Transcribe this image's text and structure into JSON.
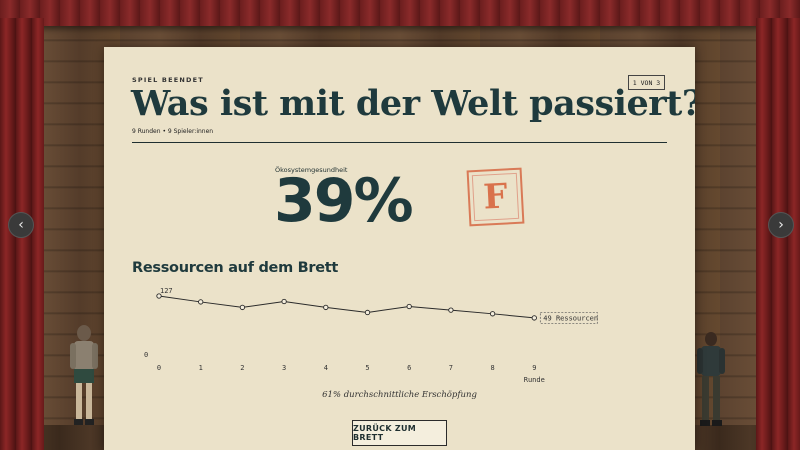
{
  "header": {
    "eyebrow": "SPIEL BEENDET",
    "title": "Was ist mit der Welt passiert?",
    "meta": "9 Runden • 9 Spieler:innen",
    "page_indicator": "1 VON 3"
  },
  "health": {
    "label": "Ökosystemgesundheit",
    "value": "39%",
    "grade": "F"
  },
  "section": {
    "title": "Ressourcen auf dem Brett"
  },
  "chart_data": {
    "type": "line",
    "title": "Ressourcen auf dem Brett",
    "xlabel": "Runde",
    "ylabel": "",
    "x": [
      0,
      1,
      2,
      3,
      4,
      5,
      6,
      7,
      8,
      9
    ],
    "series": [
      {
        "values": [
          127,
          114,
          102,
          115,
          102,
          91,
          104,
          96,
          88,
          79
        ]
      }
    ],
    "start_label": "127",
    "end_label": "49 Ressourcen",
    "y_zero_label": "0",
    "ylim": [
      0,
      127
    ],
    "grid": false
  },
  "summary": "61% durchschnittliche Erschöpfung",
  "actions": {
    "back_label": "ZURÜCK ZUM BRETT"
  },
  "nav": {
    "prev_icon": "chevron-left-icon",
    "next_icon": "chevron-right-icon",
    "prev_glyph": "‹",
    "next_glyph": "›"
  },
  "colors": {
    "card_bg": "#ebe2c9",
    "title": "#1f3a3d",
    "grade_stamp": "#d9724c",
    "curtain": "#8c2626"
  }
}
